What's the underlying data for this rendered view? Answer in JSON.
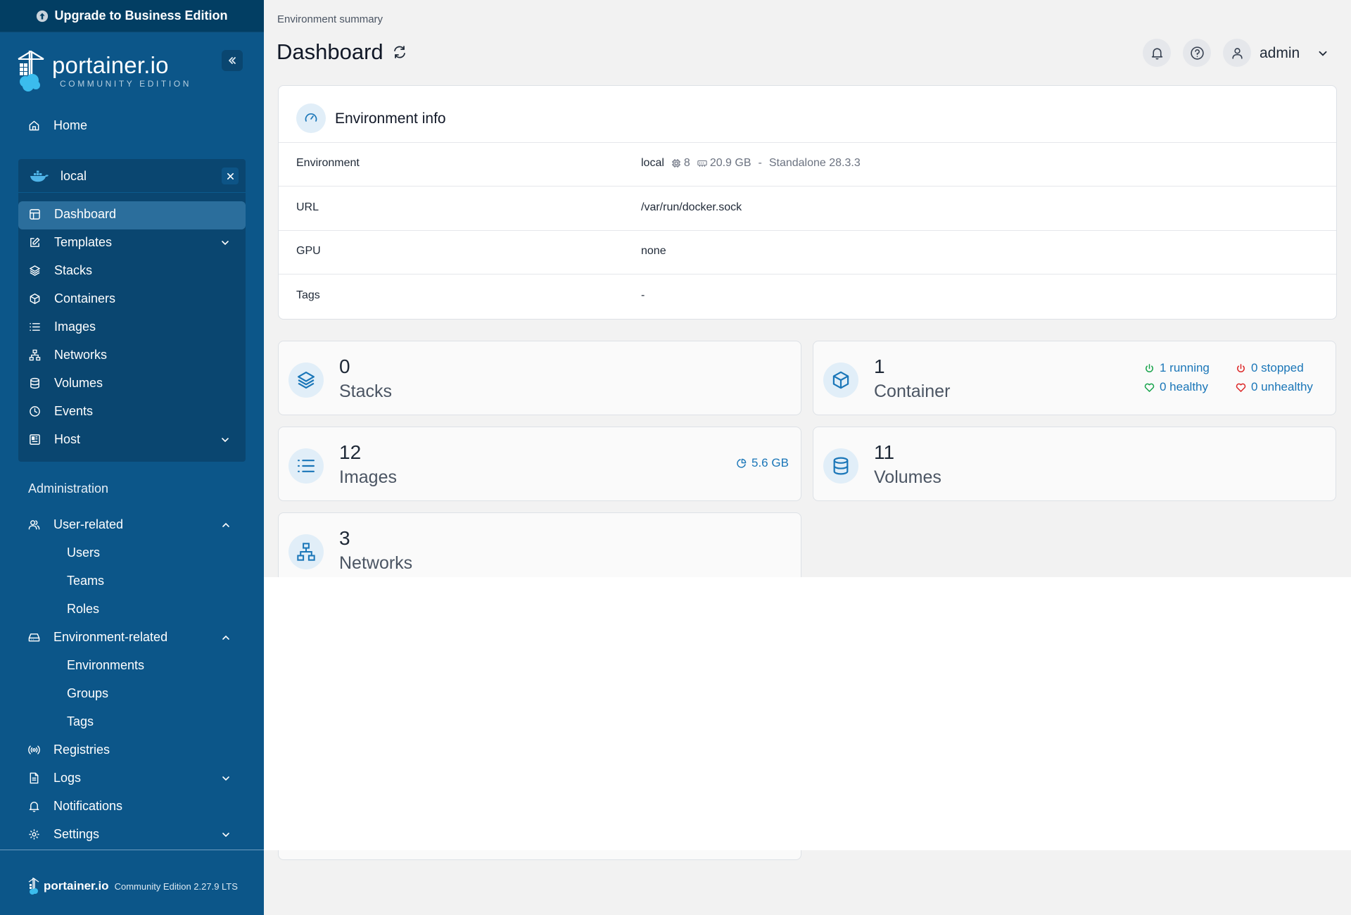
{
  "sidebar": {
    "upgrade_label": "Upgrade to Business Edition",
    "logo_text": "portainer.io",
    "logo_subtitle": "COMMUNITY EDITION",
    "home_label": "Home",
    "environment": {
      "name": "local",
      "items": [
        {
          "label": "Dashboard",
          "icon": "layout-icon"
        },
        {
          "label": "Templates",
          "icon": "edit-icon"
        },
        {
          "label": "Stacks",
          "icon": "layers-icon"
        },
        {
          "label": "Containers",
          "icon": "box-icon"
        },
        {
          "label": "Images",
          "icon": "list-icon"
        },
        {
          "label": "Networks",
          "icon": "network-icon"
        },
        {
          "label": "Volumes",
          "icon": "database-icon"
        },
        {
          "label": "Events",
          "icon": "clock-icon"
        },
        {
          "label": "Host",
          "icon": "host-icon"
        }
      ]
    },
    "administration_title": "Administration",
    "admin_items": {
      "user_related": "User-related",
      "users": "Users",
      "teams": "Teams",
      "roles": "Roles",
      "environment_related": "Environment-related",
      "environments": "Environments",
      "groups": "Groups",
      "tags": "Tags",
      "registries": "Registries",
      "logs": "Logs",
      "notifications": "Notifications",
      "settings": "Settings"
    },
    "footer": {
      "brand": "portainer.io",
      "version": "Community Edition 2.27.9 LTS"
    }
  },
  "header": {
    "breadcrumb": "Environment summary",
    "title": "Dashboard",
    "user": "admin"
  },
  "environment_info": {
    "title": "Environment info",
    "rows": {
      "environment": {
        "label": "Environment",
        "name": "local",
        "cpu": "8",
        "memory": "20.9 GB",
        "separator": "-",
        "type": "Standalone 28.3.3"
      },
      "url": {
        "label": "URL",
        "value": "/var/run/docker.sock"
      },
      "gpu": {
        "label": "GPU",
        "value": "none"
      },
      "tags": {
        "label": "Tags",
        "value": "-"
      }
    }
  },
  "stats": {
    "stacks": {
      "value": "0",
      "label": "Stacks"
    },
    "containers": {
      "value": "1",
      "label": "Container",
      "running": "1 running",
      "stopped": "0 stopped",
      "healthy": "0 healthy",
      "unhealthy": "0 unhealthy"
    },
    "images": {
      "value": "12",
      "label": "Images",
      "size": "5.6 GB"
    },
    "volumes": {
      "value": "11",
      "label": "Volumes"
    },
    "networks": {
      "value": "3",
      "label": "Networks"
    }
  },
  "colors": {
    "sidebar": "#0c5689",
    "upgrade_bar": "#023e63",
    "accent": "#1a76b8",
    "running": "#16a34a",
    "stopped": "#dc2626"
  }
}
